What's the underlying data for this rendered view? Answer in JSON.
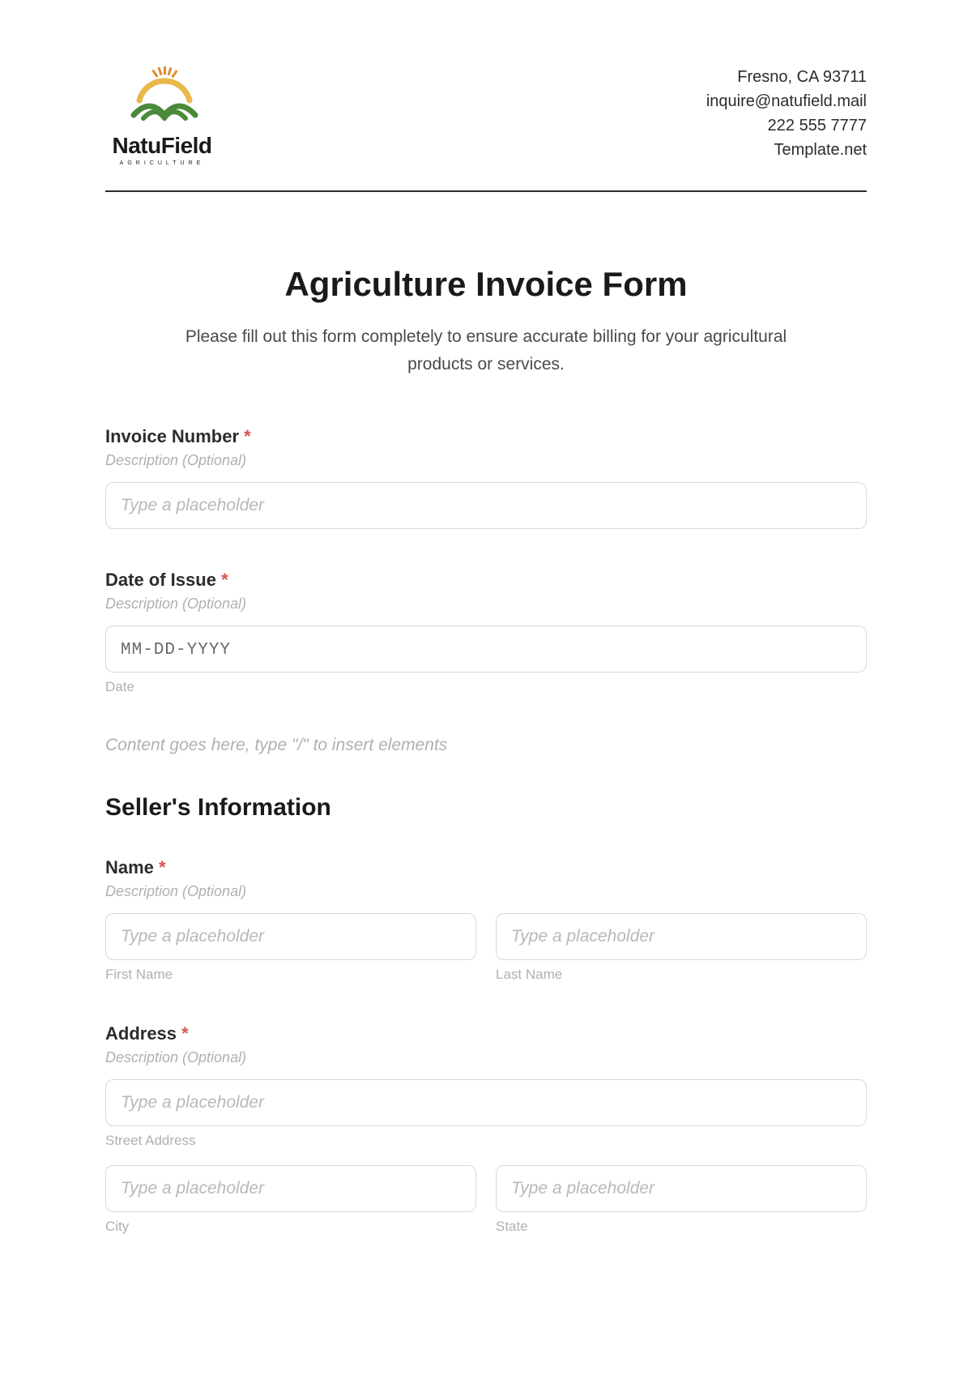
{
  "header": {
    "brand_name": "NatuField",
    "brand_sub": "AGRICULTURE",
    "contact": {
      "city_line": "Fresno, CA 93711",
      "email": "inquire@natufield.mail",
      "phone": "222 555 7777",
      "site": "Template.net"
    }
  },
  "form": {
    "title": "Agriculture Invoice Form",
    "subtitle": "Please fill out this form completely to ensure accurate billing for your agricultural products or services.",
    "required_mark": "*",
    "description_hint": "Description (Optional)",
    "generic_placeholder": "Type a placeholder",
    "invoice_number": {
      "label": "Invoice Number"
    },
    "date_of_issue": {
      "label": "Date of Issue",
      "placeholder": "MM-DD-YYYY",
      "sublabel": "Date"
    },
    "content_hint": "Content goes here, type \"/\" to insert elements",
    "seller_section": "Seller's Information",
    "name": {
      "label": "Name",
      "first_sub": "First Name",
      "last_sub": "Last Name"
    },
    "address": {
      "label": "Address",
      "street_sub": "Street Address",
      "city_sub": "City",
      "state_sub": "State"
    }
  }
}
